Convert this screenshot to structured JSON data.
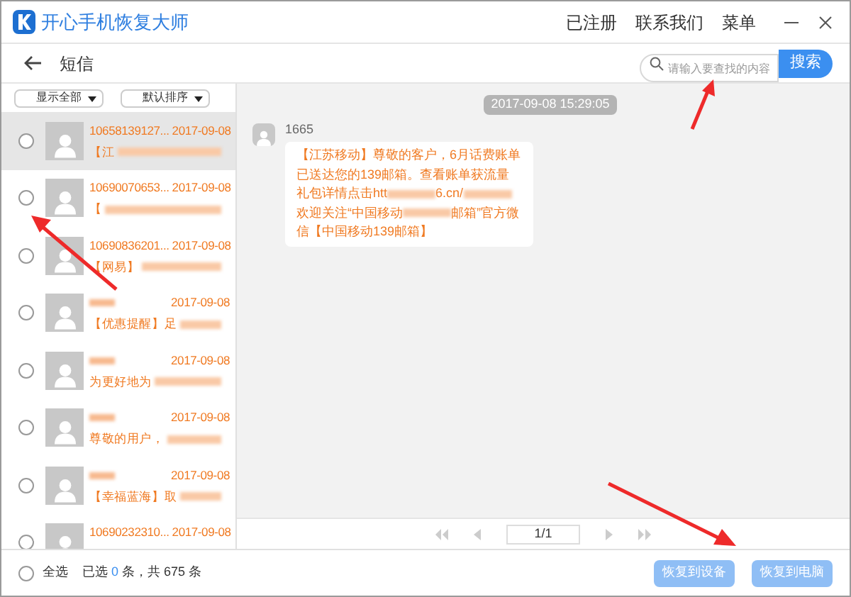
{
  "window": {
    "title": "开心手机恢复大师",
    "menu": [
      "已注册",
      "联系我们",
      "菜单"
    ]
  },
  "nav": {
    "title": "短信",
    "search": {
      "placeholder": "请输入要查找的内容",
      "button": "搜索"
    }
  },
  "filters": [
    "显示全部",
    "默认排序"
  ],
  "conversations": [
    {
      "name": "10658139127...",
      "name_blurred": false,
      "date": "2017-09-08",
      "preview": "【江",
      "selected": true,
      "checked": false
    },
    {
      "name": "10690070653...",
      "name_blurred": false,
      "date": "2017-09-08",
      "preview": "【",
      "selected": false,
      "checked": false
    },
    {
      "name": "10690836201...",
      "name_blurred": false,
      "date": "2017-09-08",
      "preview": "【网易】",
      "selected": false,
      "checked": false
    },
    {
      "name_blurred": true,
      "date": "2017-09-08",
      "preview": "【优惠提醒】足",
      "selected": false,
      "checked": false
    },
    {
      "name_blurred": true,
      "date": "2017-09-08",
      "preview": "为更好地为",
      "selected": false,
      "checked": false
    },
    {
      "name_blurred": true,
      "date": "2017-09-08",
      "preview": "尊敬的用户，",
      "selected": false,
      "checked": false
    },
    {
      "name_blurred": true,
      "date": "2017-09-08",
      "preview": "【幸福蓝海】取",
      "selected": false,
      "checked": false
    },
    {
      "name": "10690232310...",
      "name_blurred": false,
      "date": "2017-09-08",
      "selected": false,
      "checked": false
    }
  ],
  "chat": {
    "timestamp": "2017-09-08 15:29:05",
    "sender": "1665",
    "message": [
      {
        "kind": "text",
        "text": "【江苏移动】尊敬的客户，6月话费账单已送达您的139邮箱。查看账单获流量礼包详情点击htt"
      },
      {
        "kind": "blur"
      },
      {
        "kind": "text",
        "text": "6.cn/"
      },
      {
        "kind": "blur"
      },
      {
        "kind": "text",
        "text": " 欢迎关注“中国移动"
      },
      {
        "kind": "blur"
      },
      {
        "kind": "text",
        "text": "邮箱”官方微信【中国移动139邮箱】"
      }
    ]
  },
  "pager": {
    "page": "1/1"
  },
  "footer": {
    "all_checked": false,
    "select_all": "全选",
    "selected_prefix": "已选",
    "selected_count": "0",
    "selected_suffix": "条，共 675 条",
    "buttons": [
      "恢复到设备",
      "恢复到电脑"
    ]
  }
}
